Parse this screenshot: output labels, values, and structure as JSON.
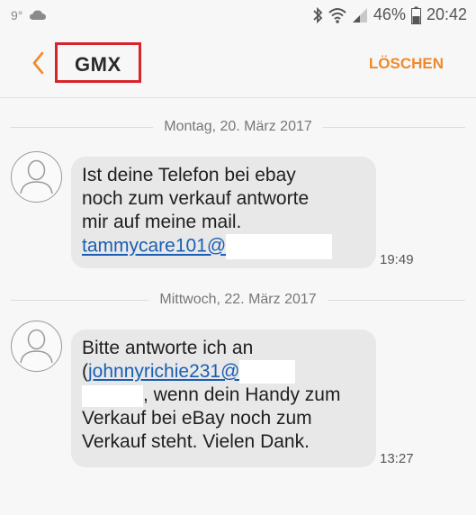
{
  "status_bar": {
    "temperature": "9°",
    "battery_percent": "46%",
    "time": "20:42"
  },
  "header": {
    "title": "GMX",
    "delete_label": "LÖSCHEN",
    "accent_color": "#ee8a2d",
    "highlight_color": "#d9232b"
  },
  "messages": [
    {
      "date": "Montag, 20. März 2017",
      "text_lines": [
        "Ist deine Telefon bei ebay",
        "noch zum verkauf antworte",
        "mir auf meine mail."
      ],
      "email": "tammycare101@",
      "time": "19:49"
    },
    {
      "date": "Mittwoch, 22. März 2017",
      "line1": "Bitte antworte ich an",
      "open_paren": "(",
      "email": "johnnyrichie231@",
      "line3_suffix": ", wenn dein Handy zum",
      "line4": "Verkauf bei eBay noch zum",
      "line5": "Verkauf steht. Vielen Dank.",
      "time": "13:27"
    }
  ]
}
